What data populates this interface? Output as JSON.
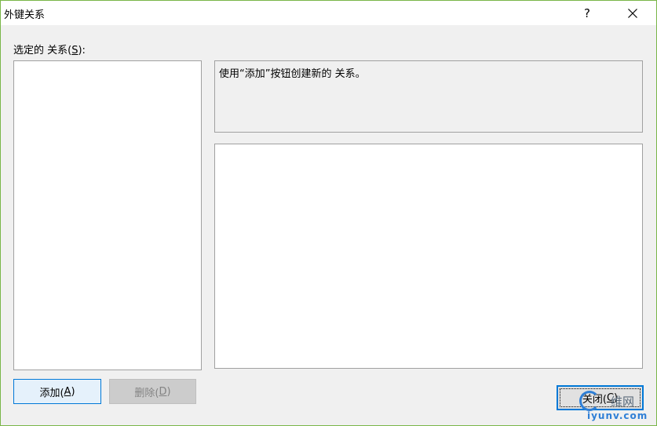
{
  "window": {
    "title": "外键关系",
    "help_label": "?",
    "close_icon": "close-icon"
  },
  "relations": {
    "label_prefix": "选定的 关系(",
    "label_key": "S",
    "label_suffix": "):",
    "items": []
  },
  "info": {
    "message": "使用“添加”按钮创建新的 关系。"
  },
  "buttons": {
    "add": {
      "prefix": "添加(",
      "key": "A",
      "suffix": ")"
    },
    "delete": {
      "prefix": "删除(",
      "key": "D",
      "suffix": ")",
      "enabled": false
    },
    "close": {
      "prefix": "关闭(",
      "key": "C",
      "suffix": ")"
    }
  },
  "watermark": {
    "brand": "维网",
    "domain": "iyunv.com"
  },
  "colors": {
    "accent": "#0078d7",
    "window_border": "#7ab648",
    "dialog_bg": "#f0f0f0"
  }
}
